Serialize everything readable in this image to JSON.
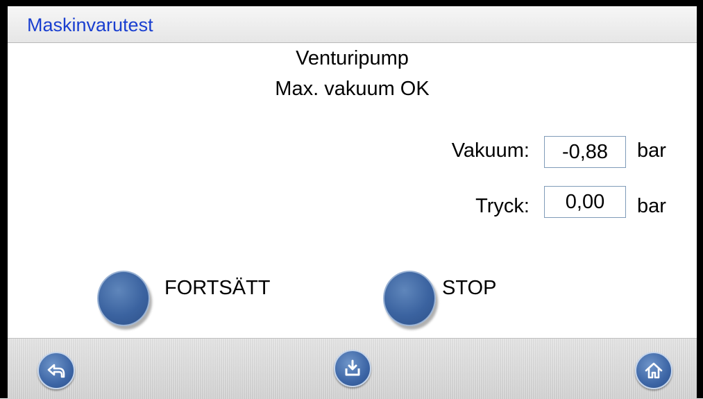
{
  "header": {
    "title": "Maskinvarutest"
  },
  "main": {
    "heading": "Venturipump",
    "subheading": "Max. vakuum OK",
    "readings": [
      {
        "label": "Vakuum:",
        "value": "-0,88",
        "unit": "bar"
      },
      {
        "label": "Tryck:",
        "value": "0,00",
        "unit": "bar"
      }
    ],
    "actions": [
      {
        "label": "FORTSÄTT"
      },
      {
        "label": "STOP"
      }
    ]
  },
  "footer": {
    "buttons": [
      {
        "icon": "back-arrow-icon"
      },
      {
        "icon": "download-icon"
      },
      {
        "icon": "home-icon"
      }
    ]
  },
  "colors": {
    "title_text": "#1a3fd0",
    "button_blue": "#3b63a0",
    "box_border": "#7f9bb8"
  }
}
